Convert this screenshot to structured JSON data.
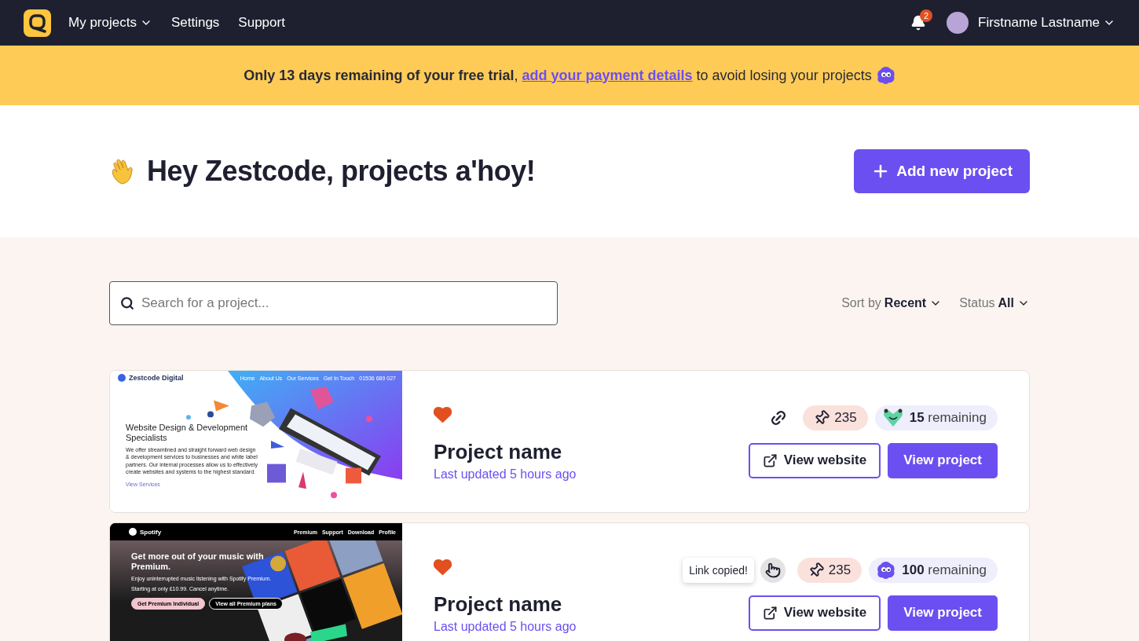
{
  "nav": {
    "items": [
      {
        "label": "My projects",
        "dropdown": true
      },
      {
        "label": "Settings",
        "dropdown": false
      },
      {
        "label": "Support",
        "dropdown": false
      }
    ],
    "notifications": "2",
    "user": "Firstname Lastname"
  },
  "banner": {
    "lead": "**Only 13 days remaining of your free trial**,",
    "link": "add your payment details",
    "tail": "to avoid losing your projects"
  },
  "hero": {
    "title": "Hey Zestcode, projects a'hoy!",
    "button": "Add new project"
  },
  "toolbar": {
    "search_placeholder": "Search for a project...",
    "sort": {
      "label": "Sort by",
      "value": "Recent"
    },
    "status": {
      "label": "Status",
      "value": "All"
    }
  },
  "projects": [
    {
      "favorite": true,
      "name": "Project name",
      "updated": "Last updated 5 hours ago",
      "link_copied": false,
      "pins": "235",
      "remaining": {
        "count": "15",
        "label": "remaining",
        "kind": "heart"
      },
      "actions": [
        "View website",
        "View project"
      ],
      "thumbnail": {
        "kind": "agency",
        "logo": "Zestcode Digital",
        "nav": [
          "Home",
          "About Us",
          "Our Services",
          "Get In Touch",
          "01536 689 027"
        ],
        "headline": "Website Design & Development Specialists",
        "body": "We offer streamlined and straight forward web design & development services to businesses and white label partners. Our internal processes allow us to effectively create websites and systems to the highest standard.",
        "link": "View Services"
      }
    },
    {
      "favorite": true,
      "name": "Project name",
      "updated": "Last updated 5 hours ago",
      "link_copied": true,
      "tooltip": "Link copied!",
      "pins": "235",
      "remaining": {
        "count": "100",
        "label": "remaining",
        "kind": "blob"
      },
      "actions": [
        "View website",
        "View project"
      ],
      "thumbnail": {
        "kind": "music",
        "logo": "Spotify",
        "nav": [
          "Premium",
          "Support",
          "Download",
          "Profile"
        ],
        "headline": "Get more out of your music with Premium.",
        "body": "Enjoy uninterrupted music listening with Spotify Premium.",
        "price": "Starting at only £10.99. Cancel anytime.",
        "buttons": [
          "Get Premium Individual",
          "View all Premium plans"
        ]
      }
    }
  ]
}
